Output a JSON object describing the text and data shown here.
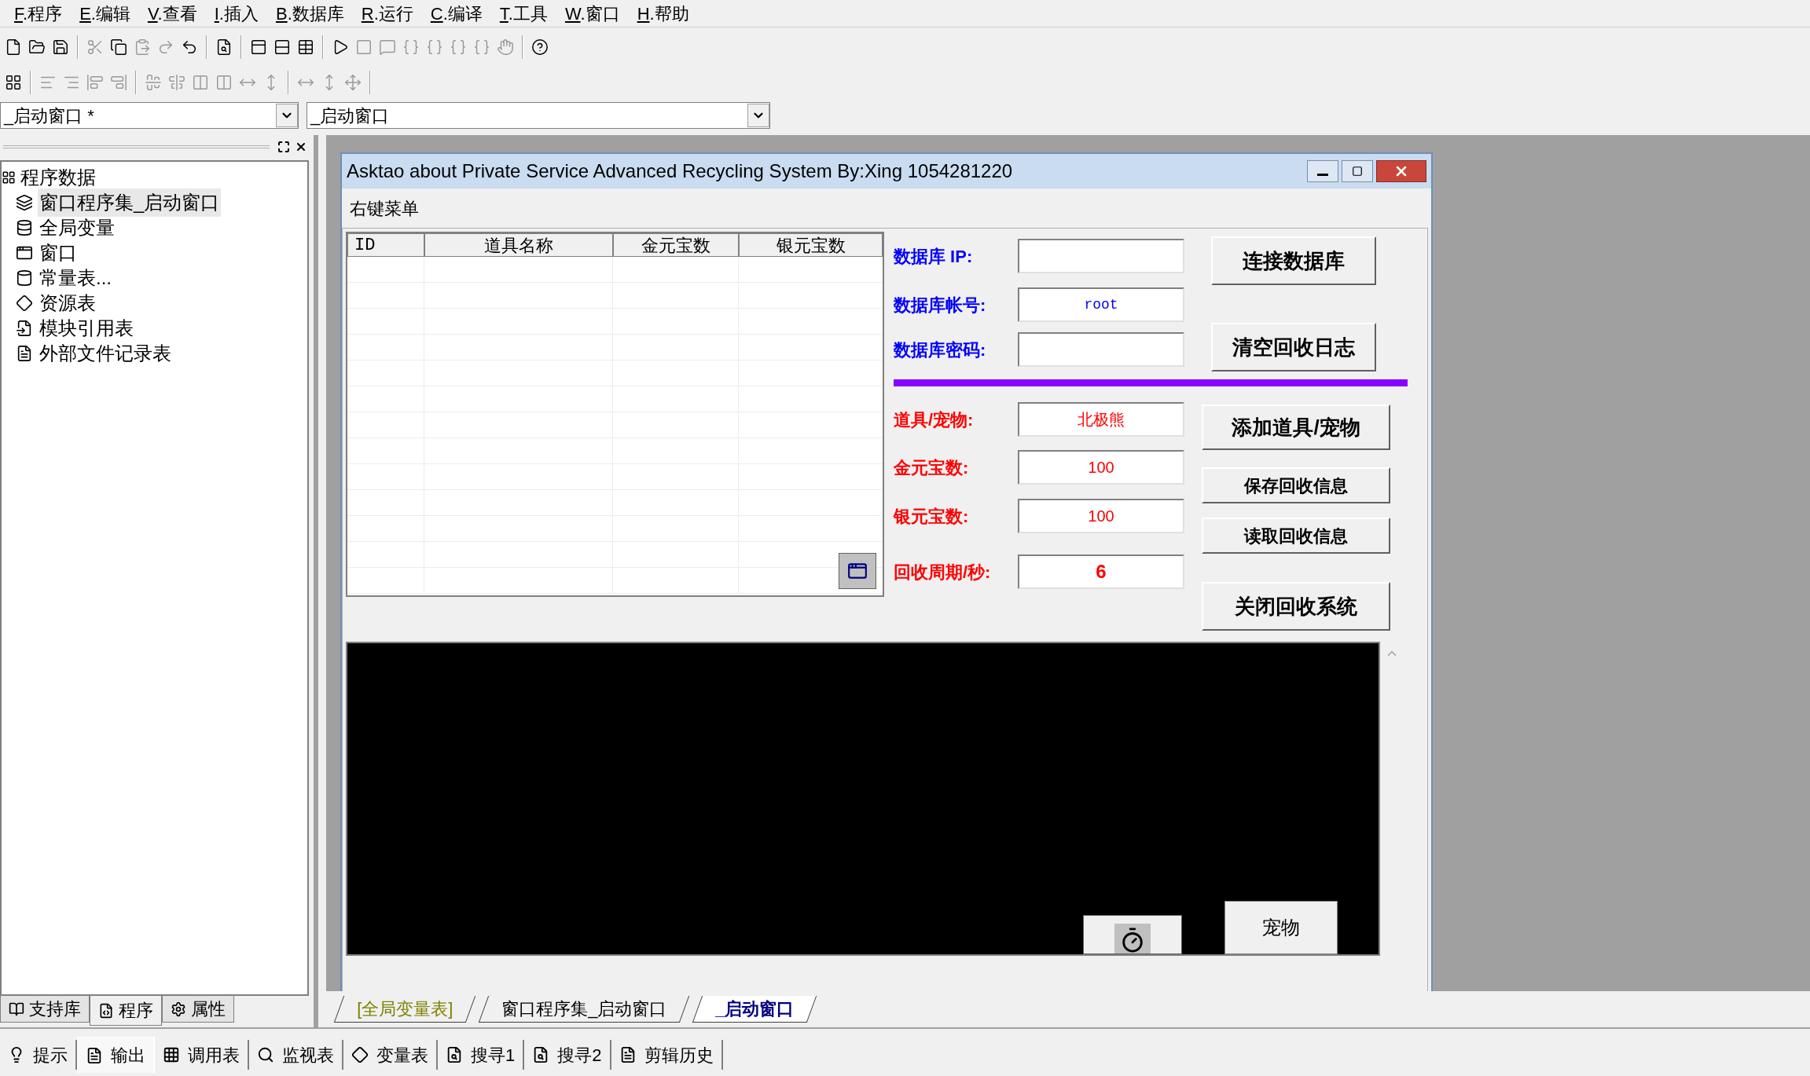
{
  "menu": [
    "F.程序",
    "E.编辑",
    "V.查看",
    "I.插入",
    "B.数据库",
    "R.运行",
    "C.编译",
    "T.工具",
    "W.窗口",
    "H.帮助"
  ],
  "combos": [
    {
      "value": "_启动窗口 *"
    },
    {
      "value": "_启动窗口"
    }
  ],
  "tree": {
    "label": "程序数据",
    "children": [
      {
        "label": "窗口程序集_启动窗口",
        "kind": "layers",
        "selected": true
      },
      {
        "label": "全局变量",
        "kind": "jar",
        "selected": false
      },
      {
        "label": "窗口",
        "kind": "window",
        "selected": false
      },
      {
        "label": "常量表...",
        "kind": "cylinders",
        "selected": false
      },
      {
        "label": "资源表",
        "kind": "diamonds",
        "selected": false
      },
      {
        "label": "模块引用表",
        "kind": "import",
        "selected": false
      },
      {
        "label": "外部文件记录表",
        "kind": "file",
        "selected": false
      }
    ]
  },
  "left_tabs": [
    {
      "label": "支持库",
      "selected": false
    },
    {
      "label": "程序",
      "selected": true
    },
    {
      "label": "属性",
      "selected": false
    }
  ],
  "form": {
    "title": "Asktao about Private Service Advanced Recycling System By:Xing 1054281220",
    "menu_item": "右键菜单",
    "table": {
      "columns": [
        "ID",
        "道具名称",
        "金元宝数",
        "银元宝数"
      ]
    },
    "fields": [
      {
        "label": "数据库 IP:",
        "color": "#0000ff"
      },
      {
        "label": "数据库帐号:",
        "value": "root",
        "color": "#0000ff"
      },
      {
        "label": "数据库密码:",
        "color": "#0000ff"
      },
      {
        "label": "道具/宠物:",
        "value": "北极熊",
        "color": "#ff0000"
      },
      {
        "label": "金元宝数:",
        "value": "100",
        "color": "#ff0000"
      },
      {
        "label": "银元宝数:",
        "value": "100",
        "color": "#ff0000"
      },
      {
        "label": "回收周期/秒:",
        "value": "6",
        "color": "#ff0000"
      }
    ],
    "buttons": [
      "连接数据库",
      "清空回收日志",
      "添加道具/宠物",
      "保存回收信息",
      "读取回收信息",
      "关闭回收系统"
    ],
    "pet_button": "宠物"
  },
  "editor_tabs": [
    {
      "label": "[全局变量表]",
      "selected": false,
      "color": "#808000"
    },
    {
      "label": "窗口程序集_启动窗口",
      "selected": false,
      "color": "#000000"
    },
    {
      "label": "_启动窗口",
      "selected": true,
      "color": "#000080"
    }
  ],
  "bottom_tabs": [
    {
      "label": "提示",
      "selected": false
    },
    {
      "label": "输出",
      "selected": true
    },
    {
      "label": "调用表",
      "selected": false
    },
    {
      "label": "监视表",
      "selected": false
    },
    {
      "label": "变量表",
      "selected": false
    },
    {
      "label": "搜寻1",
      "selected": false
    },
    {
      "label": "搜寻2",
      "selected": false
    },
    {
      "label": "剪辑历史",
      "selected": false
    }
  ]
}
